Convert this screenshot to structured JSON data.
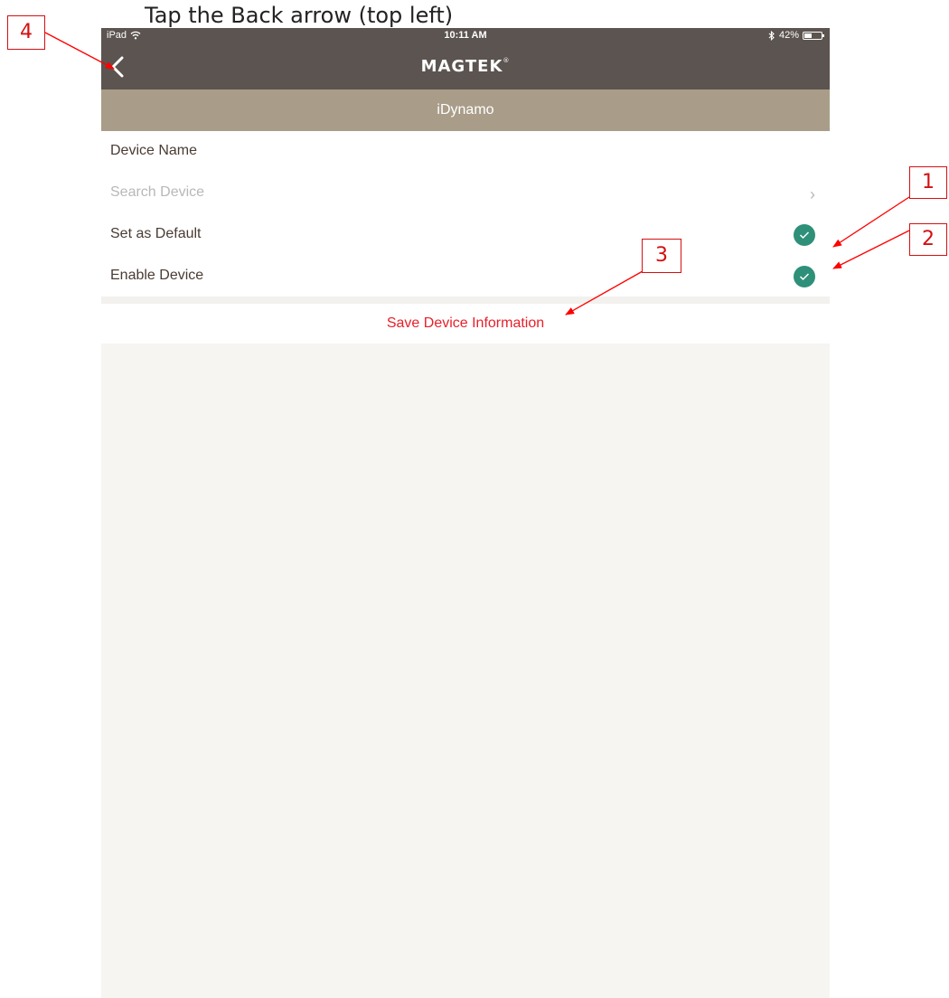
{
  "caption": "Tap the Back arrow (top left)",
  "status_bar": {
    "device": "iPad",
    "time": "10:11 AM",
    "battery_percent": "42%",
    "battery_level": 0.42
  },
  "header": {
    "logo": "MAGTEK",
    "logo_mark": "®"
  },
  "subtitle": "iDynamo",
  "rows": [
    {
      "label": "Device Name"
    },
    {
      "label": "Search Device"
    },
    {
      "label": "Set as Default",
      "checked": true
    },
    {
      "label": "Enable Device",
      "checked": true
    }
  ],
  "save_label": "Save Device Information",
  "annotations": [
    "1",
    "2",
    "3",
    "4"
  ],
  "colors": {
    "header_bg": "#5c5450",
    "subtitle_bg": "#a99d89",
    "check_green": "#2e9078",
    "save_red": "#e8202a",
    "annotation_red": "#d41010"
  }
}
